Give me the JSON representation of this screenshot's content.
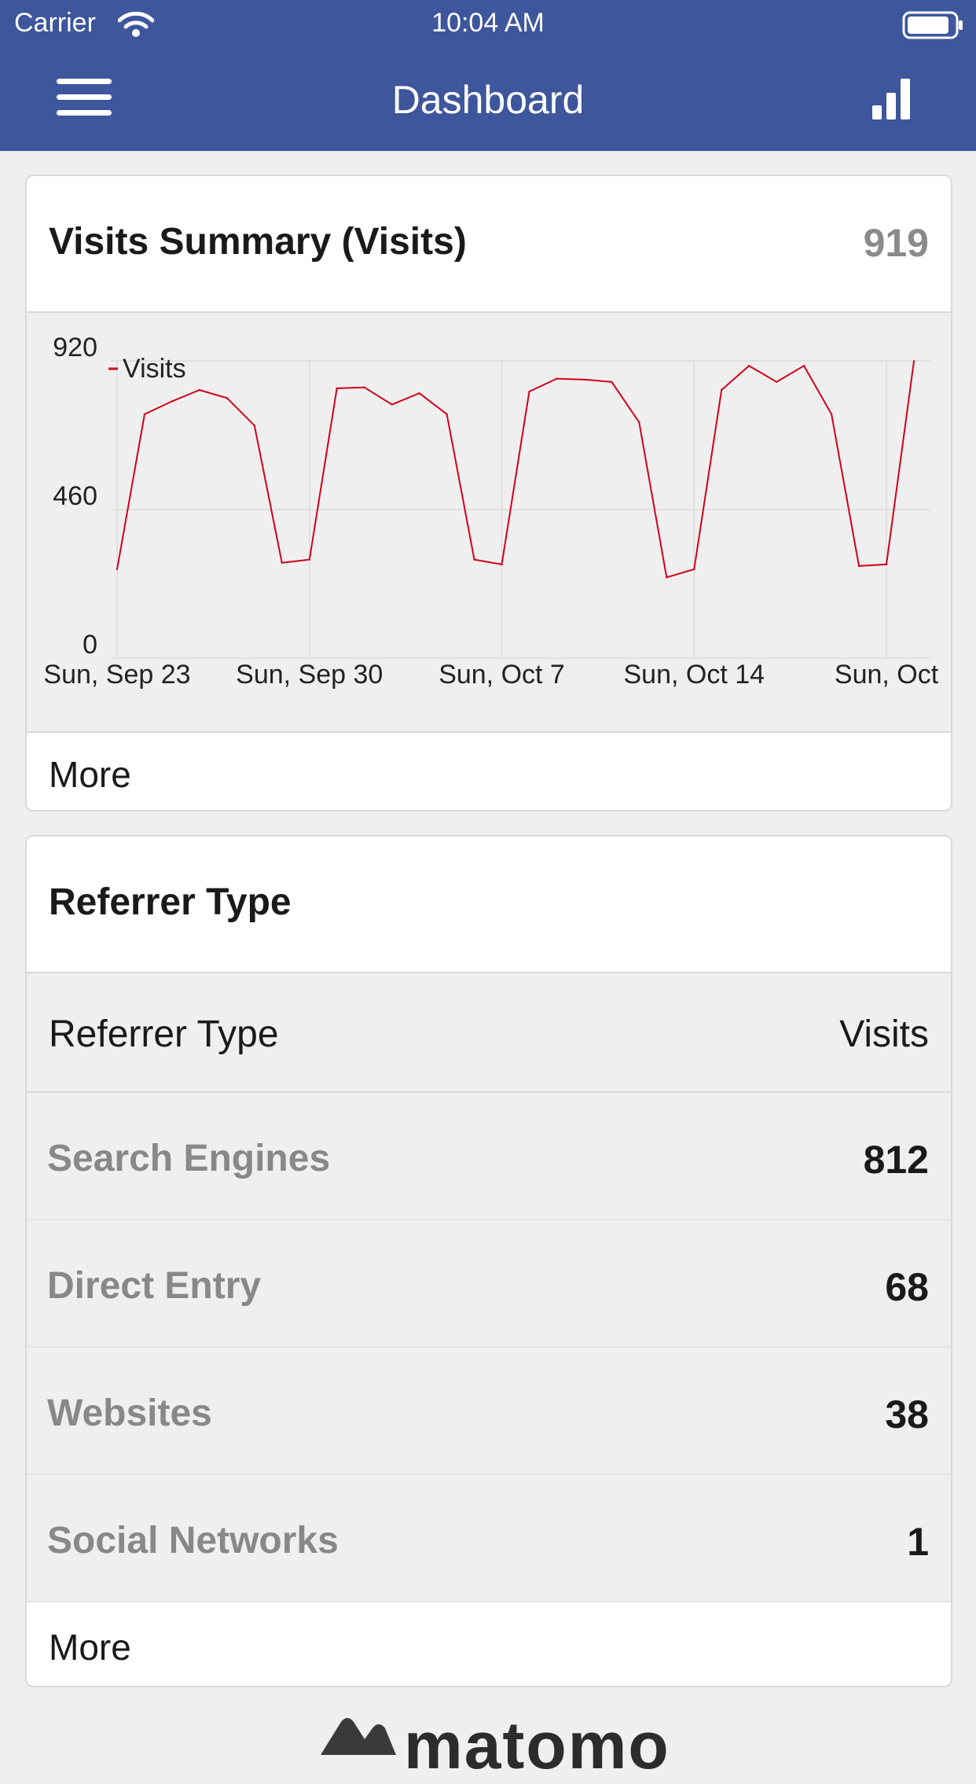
{
  "status_bar": {
    "carrier": "Carrier",
    "time": "10:04 AM"
  },
  "nav": {
    "title": "Dashboard",
    "bar_color": "#3d569c",
    "menu_icon": "hamburger-menu-icon",
    "right_icon": "bar-chart-icon"
  },
  "visits_summary": {
    "title": "Visits Summary (Visits)",
    "total": "919",
    "more_label": "More"
  },
  "chart_data": {
    "type": "line",
    "title": "",
    "legend": [
      "Visits"
    ],
    "legend_placement": "top-left",
    "series_color": "#d0021b",
    "grid": true,
    "ylim": [
      0,
      920
    ],
    "yticks": [
      "920",
      "460",
      "0"
    ],
    "x_tick_labels": [
      "Sun, Sep 23",
      "Sun, Sep 30",
      "Sun, Oct 7",
      "Sun, Oct 14",
      "Sun, Oct"
    ],
    "x_tick_days": [
      0,
      7,
      14,
      21,
      28
    ],
    "x_dates": [
      "Sep 23",
      "Sep 24",
      "Sep 25",
      "Sep 26",
      "Sep 27",
      "Sep 28",
      "Sep 29",
      "Sep 30",
      "Oct 1",
      "Oct 2",
      "Oct 3",
      "Oct 4",
      "Oct 5",
      "Oct 6",
      "Oct 7",
      "Oct 8",
      "Oct 9",
      "Oct 10",
      "Oct 11",
      "Oct 12",
      "Oct 13",
      "Oct 14",
      "Oct 15",
      "Oct 16",
      "Oct 17",
      "Oct 18",
      "Oct 19",
      "Oct 20",
      "Oct 21",
      "Oct 22"
    ],
    "series": [
      {
        "name": "Visits",
        "values": [
          275,
          755,
          795,
          830,
          805,
          720,
          295,
          305,
          835,
          838,
          785,
          820,
          755,
          305,
          290,
          825,
          865,
          862,
          855,
          730,
          250,
          275,
          830,
          905,
          855,
          905,
          755,
          285,
          290,
          919
        ]
      }
    ]
  },
  "referrer_type": {
    "title": "Referrer Type",
    "column_label": "Referrer Type",
    "column_value": "Visits",
    "rows": [
      {
        "label": "Search Engines",
        "value": "812"
      },
      {
        "label": "Direct Entry",
        "value": "68"
      },
      {
        "label": "Websites",
        "value": "38"
      },
      {
        "label": "Social Networks",
        "value": "1"
      }
    ],
    "more_label": "More"
  },
  "footer": {
    "logo_text": "matomo"
  }
}
